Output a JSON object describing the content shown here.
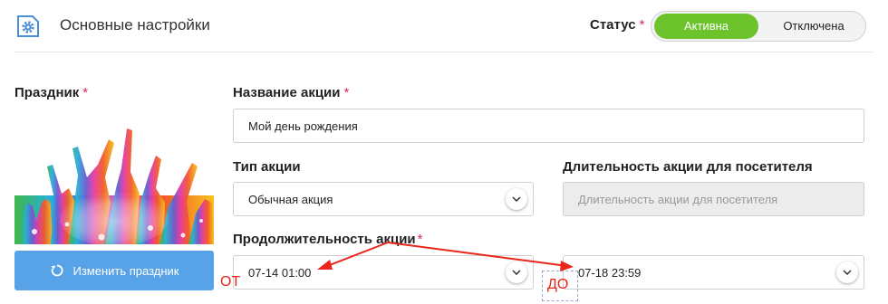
{
  "header": {
    "title": "Основные настройки",
    "status_label": "Статус",
    "required_mark": "*",
    "status_active": "Активна",
    "status_inactive": "Отключена"
  },
  "holiday": {
    "label": "Праздник",
    "required_mark": "*",
    "change_button": "Изменить праздник"
  },
  "form": {
    "name_label": "Название акции",
    "name_required": "*",
    "name_value": "Мой день рождения",
    "type_label": "Тип акции",
    "type_value": "Обычная акция",
    "visitor_duration_label": "Длительность акции для посетителя",
    "visitor_duration_placeholder": "Длительность акции для посетителя",
    "period_label": "Продолжительность акции",
    "period_required": "*",
    "period_from": "07-14 01:00",
    "period_to": "07-18 23:59"
  },
  "annotations": {
    "from": "ОТ",
    "to": "ДО"
  },
  "colors": {
    "active_green": "#6cc32b",
    "button_blue": "#58a2e8",
    "required_red": "#e0245e",
    "annotation_red": "#e8261a"
  },
  "icons": {
    "header": "settings-gear-icon",
    "change_button": "refresh-icon",
    "dropdown": "chevron-down-icon"
  }
}
